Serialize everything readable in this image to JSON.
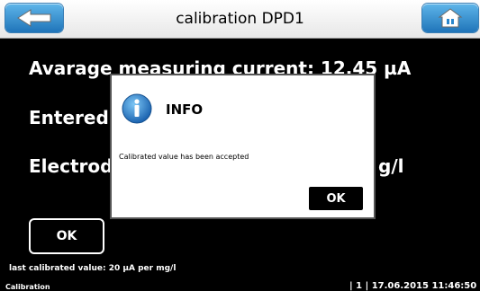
{
  "header": {
    "title": "calibration DPD1",
    "back_icon": "back-arrow-icon",
    "home_icon": "home-icon",
    "accent": "#2a86cc"
  },
  "main": {
    "line1": "Avarage measuring current: 12.45 µA",
    "line2": "Entered",
    "line3_left": "Electrod",
    "line3_right": "g/l",
    "ok_label": "OK"
  },
  "dialog": {
    "title": "INFO",
    "icon": "info-icon",
    "message": "Calibrated value has been accepted",
    "ok_label": "OK"
  },
  "status": {
    "last_calibrated": "last calibrated value: 20 µA per mg/l",
    "footer_left": "Calibration",
    "footer_right": "| 1 | 17.06.2015 11:46:50"
  }
}
